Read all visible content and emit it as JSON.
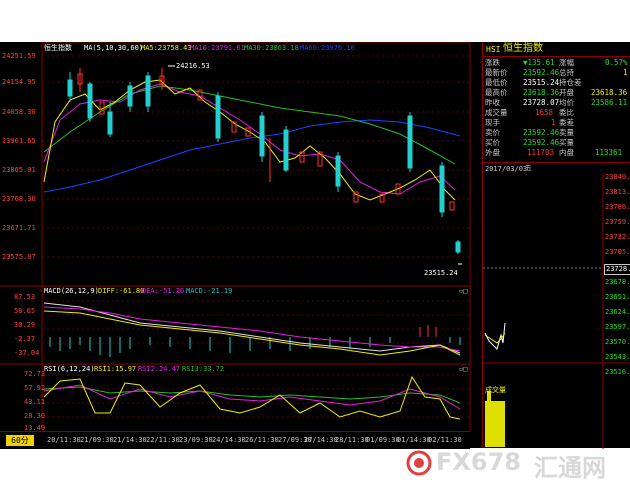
{
  "main_chart": {
    "title": "恒生指数",
    "ma_label": "MA(5,10,30,60)",
    "ma5": "MA5:23758.43",
    "ma10": "MA10:23791.61",
    "ma30": "MA30:23863.18",
    "ma60": "MA60:23976.10",
    "high_label": "24216.53",
    "low_label": "23515.24",
    "price_ticks": [
      "24251.59",
      "24154.95",
      "24058.30",
      "23961.65",
      "23865.01",
      "23768.36",
      "23671.71",
      "23575.07"
    ]
  },
  "macd_panel": {
    "label": "MACD(26,12,9)",
    "diff": "DIFF:-61.80",
    "dea": "DEA:-51.20",
    "macd": "MACD:-21.19",
    "ticks": [
      "87.53",
      "58.65",
      "30.29",
      "-2.37",
      "-37.04"
    ]
  },
  "rsi_panel": {
    "label": "RSI(6,12,24)",
    "rsi1": "RSI1:15.97",
    "rsi2": "RSI2:24.47",
    "rsi3": "RSI3:33.72",
    "ticks": [
      "72.73",
      "57.92",
      "43.11",
      "28.30",
      "13.49"
    ]
  },
  "period_button": "60分",
  "x_ticks": [
    "20/11:30",
    "21/09:30",
    "21/14:30",
    "22/11:30",
    "23/09:30",
    "24/14:30",
    "26/11:30",
    "27/09:30",
    "27/14:30",
    "28/11:30",
    "01/09:30",
    "01/14:30",
    "02/11:30"
  ],
  "quote": {
    "code": "HSI",
    "name": "恒生指数",
    "rows": [
      {
        "k1": "涨跌",
        "v1": "▼135.61",
        "k2": "涨幅",
        "v2": "0.57%"
      },
      {
        "k1": "最新价",
        "v1": "23592.46",
        "k2": "总持",
        "v2": "1"
      },
      {
        "k1": "最低价",
        "v1": "23515.24",
        "k2": "持仓差",
        "v2": ""
      },
      {
        "k1": "最高价",
        "v1": "23618.36",
        "k2": "开盘",
        "v2": "23618.36"
      },
      {
        "k1": "昨收",
        "v1": "23728.07",
        "k2": "均价",
        "v2": "23586.11"
      },
      {
        "k1": "成交量",
        "v1": "1658",
        "k2": "委比",
        "v2": ""
      },
      {
        "k1": "现手",
        "v1": "1",
        "k2": "委差",
        "v2": ""
      },
      {
        "k1": "卖价",
        "v1": "23592.46",
        "k2": "卖量",
        "v2": ""
      },
      {
        "k1": "买价",
        "v1": "23592.46",
        "k2": "买量",
        "v2": ""
      },
      {
        "k1": "外盘",
        "v1": "111703",
        "k2": "内盘",
        "v2": "113361"
      }
    ],
    "date": "2017/03/03",
    "weekday": "五",
    "intraday_ticks": [
      "23840.93",
      "23813.91",
      "23786.89",
      "23759.87",
      "23732.85",
      "23705.83",
      "23678.81",
      "23651.79",
      "23624.77",
      "23597.75",
      "23570.73",
      "23543.71",
      "23516.69"
    ],
    "prev_close_box": "23728.07",
    "volume_label": "成交量"
  },
  "watermark": {
    "text_fx": "FX678",
    "text_cn": "汇通网"
  }
}
